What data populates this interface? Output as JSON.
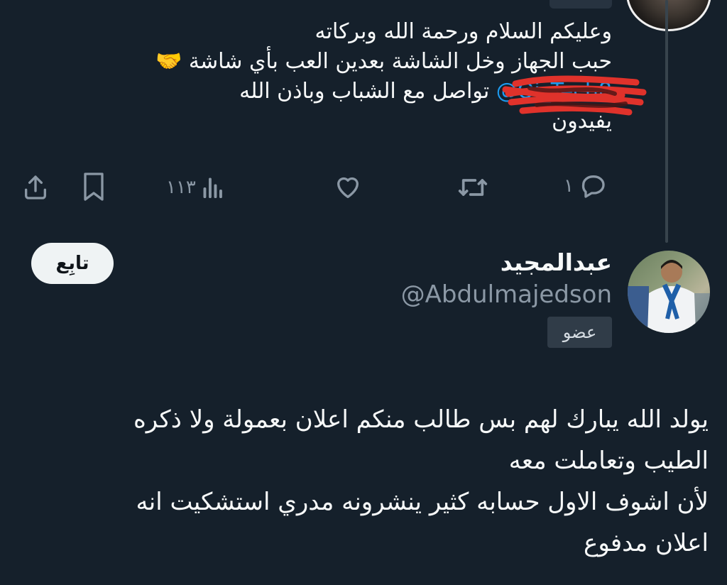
{
  "reply_tweet": {
    "text_part1": "وعليكم السلام ورحمة الله وبركاته\nحبب الجهاز وخل الشاشة بعدين العب بأي شاشة 🤝\n",
    "mention": "@Qj_Tech8",
    "text_part2": " تواصل مع الشباب وباذن الله\nيفيدون",
    "actions": {
      "reply_count": "١",
      "retweet_count": "",
      "like_count": "",
      "views_count": "١١٣"
    }
  },
  "user_card": {
    "display_name": "عبدالمجيد",
    "handle": "@Abdulmajedson",
    "badge": "عضو",
    "follow_label": "تابِع"
  },
  "main_tweet": {
    "text": "يولد الله يبارك لهم بس طالب منكم اعلان بعمولة ولا ذكره\nالطيب وتعاملت معه\nلأن اشوف الاول حسابه كثير ينشرونه مدري استشكيت انه\nاعلان مدفوع"
  },
  "colors": {
    "background": "#15202b",
    "text": "#f7f9f9",
    "muted": "#8b98a5",
    "link": "#1d9bf0",
    "redaction": "#e0322b"
  },
  "icons": [
    "share-icon",
    "bookmark-icon",
    "views-icon",
    "like-icon",
    "retweet-icon",
    "reply-icon"
  ]
}
